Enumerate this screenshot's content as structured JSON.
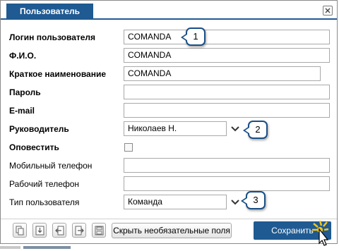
{
  "dialog": {
    "title": "Пользователь",
    "close_icon": "close-icon"
  },
  "fields": {
    "login": {
      "label": "Логин пользователя",
      "value": "COMANDA"
    },
    "fio": {
      "label": "Ф.И.О.",
      "value": "COMANDA"
    },
    "short_name": {
      "label": "Краткое наименование",
      "value": "COMANDA"
    },
    "password": {
      "label": "Пароль",
      "value": ""
    },
    "email": {
      "label": "E-mail",
      "value": ""
    },
    "manager": {
      "label": "Руководитель",
      "value": "Николаев Н."
    },
    "notify": {
      "label": "Оповестить",
      "checked": false
    },
    "mobile_phone": {
      "label": "Мобильный телефон",
      "value": ""
    },
    "work_phone": {
      "label": "Рабочий телефон",
      "value": ""
    },
    "user_type": {
      "label": "Тип пользователя",
      "value": "Команда"
    }
  },
  "callouts": [
    "1",
    "2",
    "3"
  ],
  "toolbar": {
    "icons": [
      "copy-icon",
      "import-icon",
      "back-icon",
      "forward-icon",
      "save-disk-icon"
    ],
    "hide_optional_label": "Скрыть необязательные поля",
    "save_label": "Сохранить"
  },
  "colors": {
    "accent": "#1f5a92",
    "border": "#a9a9a9",
    "callout_border": "#1a4f86",
    "cursor_highlight": "#f5c518"
  }
}
